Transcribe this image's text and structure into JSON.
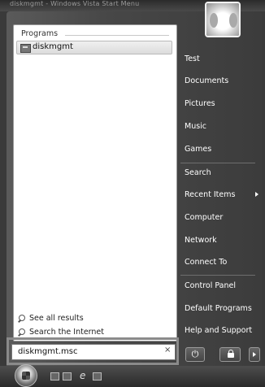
{
  "background_title": "diskmgmt - Windows Vista Start Menu",
  "left_pane": {
    "programs_header": "Programs",
    "program_item": "diskmgmt",
    "see_all_results": "See all results",
    "search_internet": "Search the Internet"
  },
  "right_pane": {
    "items": [
      "Test",
      "Documents",
      "Pictures",
      "Music",
      "Games",
      "Search",
      "Recent Items",
      "Computer",
      "Network",
      "Connect To",
      "Control Panel",
      "Default Programs",
      "Help and Support"
    ]
  },
  "search": {
    "value": "diskmgmt.msc",
    "clear_glyph": "×"
  },
  "power": {
    "power_glyph": "⏻"
  }
}
